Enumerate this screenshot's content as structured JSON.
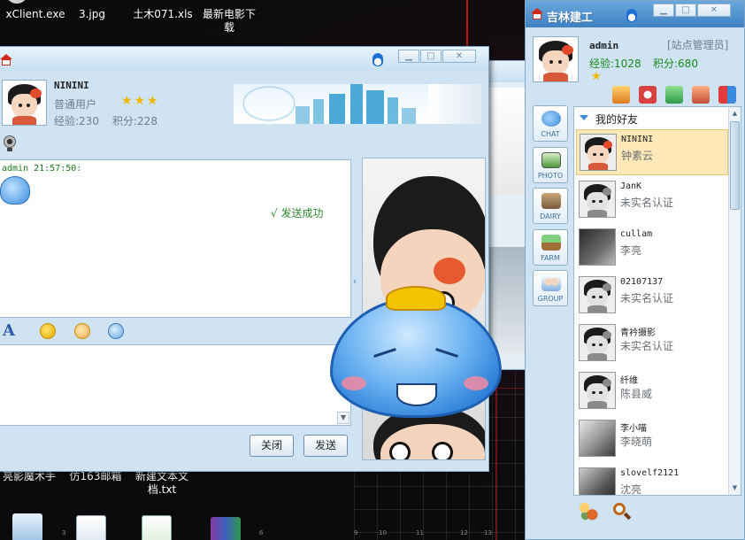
{
  "desktop": {
    "icons": [
      {
        "label": "xClient.exe"
      },
      {
        "label": "3.jpg"
      },
      {
        "label": "土木071.xls"
      },
      {
        "label": "最新电影下载"
      },
      {
        "label": "亮影魔术手"
      },
      {
        "label": "仿163邮箱"
      },
      {
        "label": "新建文本文档.txt"
      }
    ],
    "ruler_marks": [
      "3",
      "6",
      "9",
      "10",
      "11",
      "12",
      "13"
    ]
  },
  "chat_window": {
    "contact": {
      "nickname": "NININI",
      "level": "普通用户",
      "stars": "★★★",
      "exp": "经验:230",
      "points": "积分:228"
    },
    "message": {
      "sender_time": "admin  21:57:50:",
      "status": "√ 发送成功"
    },
    "toolbar": {
      "font_label": "A"
    },
    "buttons": {
      "close": "关闭",
      "send": "发送"
    }
  },
  "buddy_window": {
    "title": "吉林建工",
    "me": {
      "name": "admin",
      "role": "[站点管理员]",
      "exp": "经验:1028",
      "points": "积分:680",
      "star": "★"
    },
    "rail": [
      "CHAT",
      "PHOTO",
      "DAIRY",
      "FARM",
      "GROUP"
    ],
    "group_name": "我的好友",
    "friends": [
      {
        "nick": "NININI",
        "real": "钟素云",
        "selected": true
      },
      {
        "nick": "JanK",
        "real": "未实名认证"
      },
      {
        "nick": "cullam",
        "real": "李亮"
      },
      {
        "nick": "02107137",
        "real": "未实名认证"
      },
      {
        "nick": "青衿摄影",
        "real": "未实名认证"
      },
      {
        "nick": "纤维",
        "real": "陈县威"
      },
      {
        "nick": "李小喵",
        "real": "李晓萌"
      },
      {
        "nick": "slovelf2121",
        "real": "沈亮"
      }
    ]
  },
  "colors": {
    "accent": "#3e82c4",
    "success": "#2b8a2b",
    "selected_row": "#ffe9b8"
  }
}
